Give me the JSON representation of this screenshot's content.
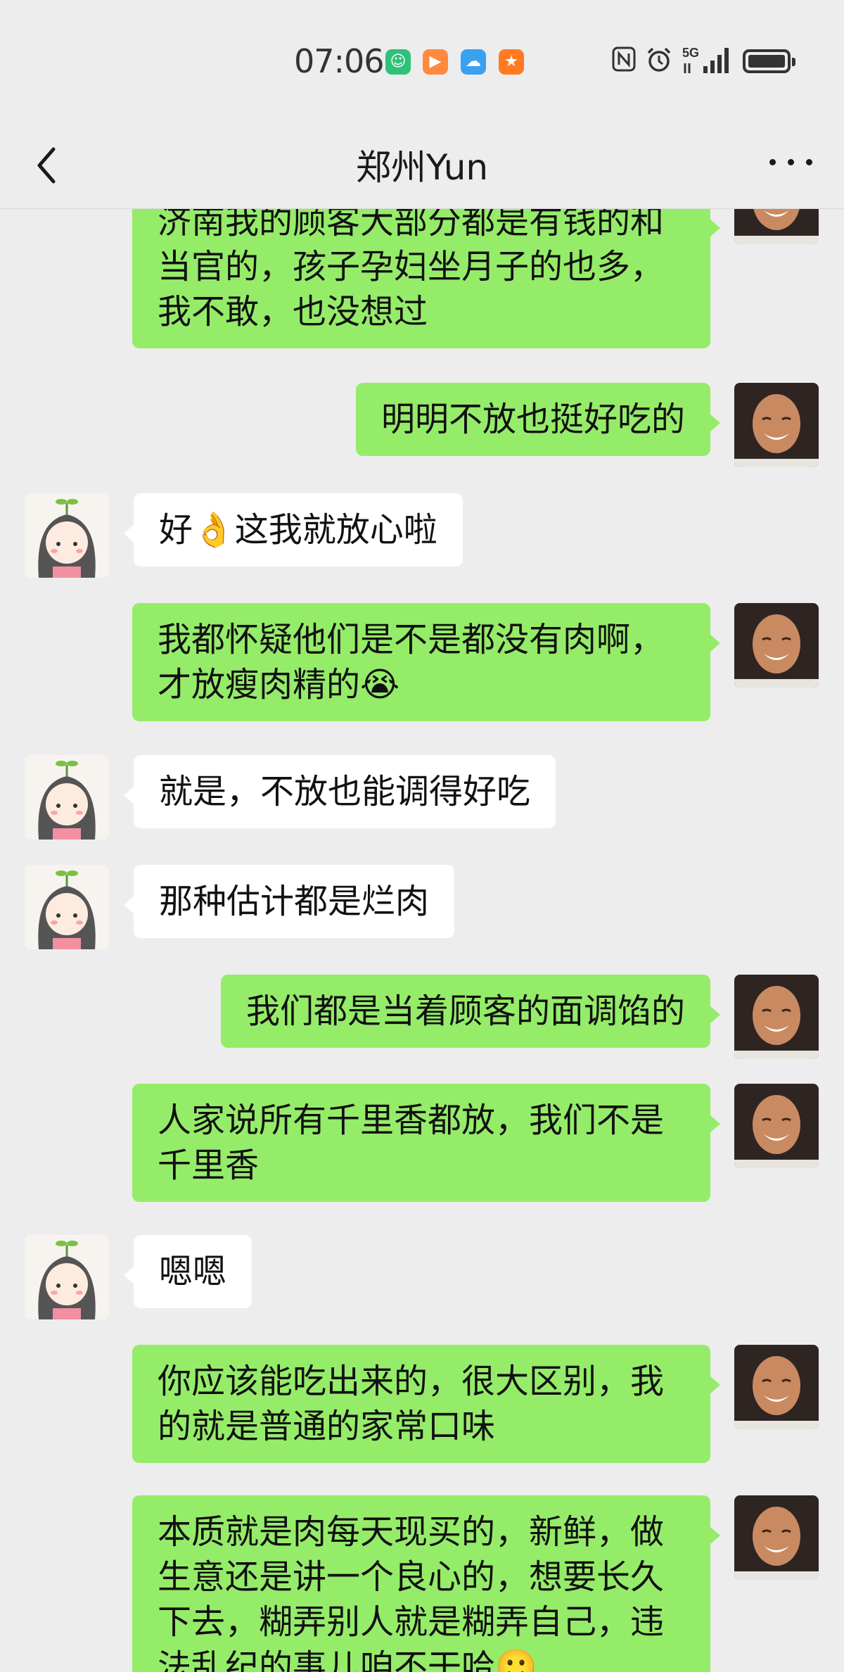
{
  "status_bar": {
    "time": "07:06",
    "app_icons": [
      "messaging-app-icon",
      "video-app-icon",
      "weather-app-icon",
      "shopping-app-icon"
    ],
    "system_icons": [
      "nfc-icon",
      "alarm-icon",
      "5g-signal-icon",
      "battery-icon"
    ],
    "network": "5G"
  },
  "nav": {
    "back_icon": "chevron-left-icon",
    "title": "郑州Yun",
    "more_icon": "more-dots-icon"
  },
  "messages": [
    {
      "side": "right",
      "text": "济南我的顾客大部分都是有钱的和当官的，孩子孕妇坐月子的也多，我不敢，也没想过"
    },
    {
      "side": "right",
      "text": "明明不放也挺好吃的"
    },
    {
      "side": "left",
      "text": "好👌这我就放心啦"
    },
    {
      "side": "right",
      "text": "我都怀疑他们是不是都没有肉啊，才放瘦肉精的😭"
    },
    {
      "side": "left",
      "text": "就是，不放也能调得好吃"
    },
    {
      "side": "left",
      "text": "那种估计都是烂肉"
    },
    {
      "side": "right",
      "text": "我们都是当着顾客的面调馅的"
    },
    {
      "side": "right",
      "text": "人家说所有千里香都放，我们不是千里香"
    },
    {
      "side": "left",
      "text": "嗯嗯"
    },
    {
      "side": "right",
      "text": "你应该能吃出来的，很大区别，我的就是普通的家常口味"
    },
    {
      "side": "right",
      "text": "本质就是肉每天现买的，新鲜，做生意还是讲一个良心的，想要长久下去，糊弄别人就是糊弄自己，违法乱纪的事儿咱不干哈🙂"
    }
  ],
  "colors": {
    "background": "#ededed",
    "self_bubble": "#95ec69",
    "other_bubble": "#ffffff"
  }
}
